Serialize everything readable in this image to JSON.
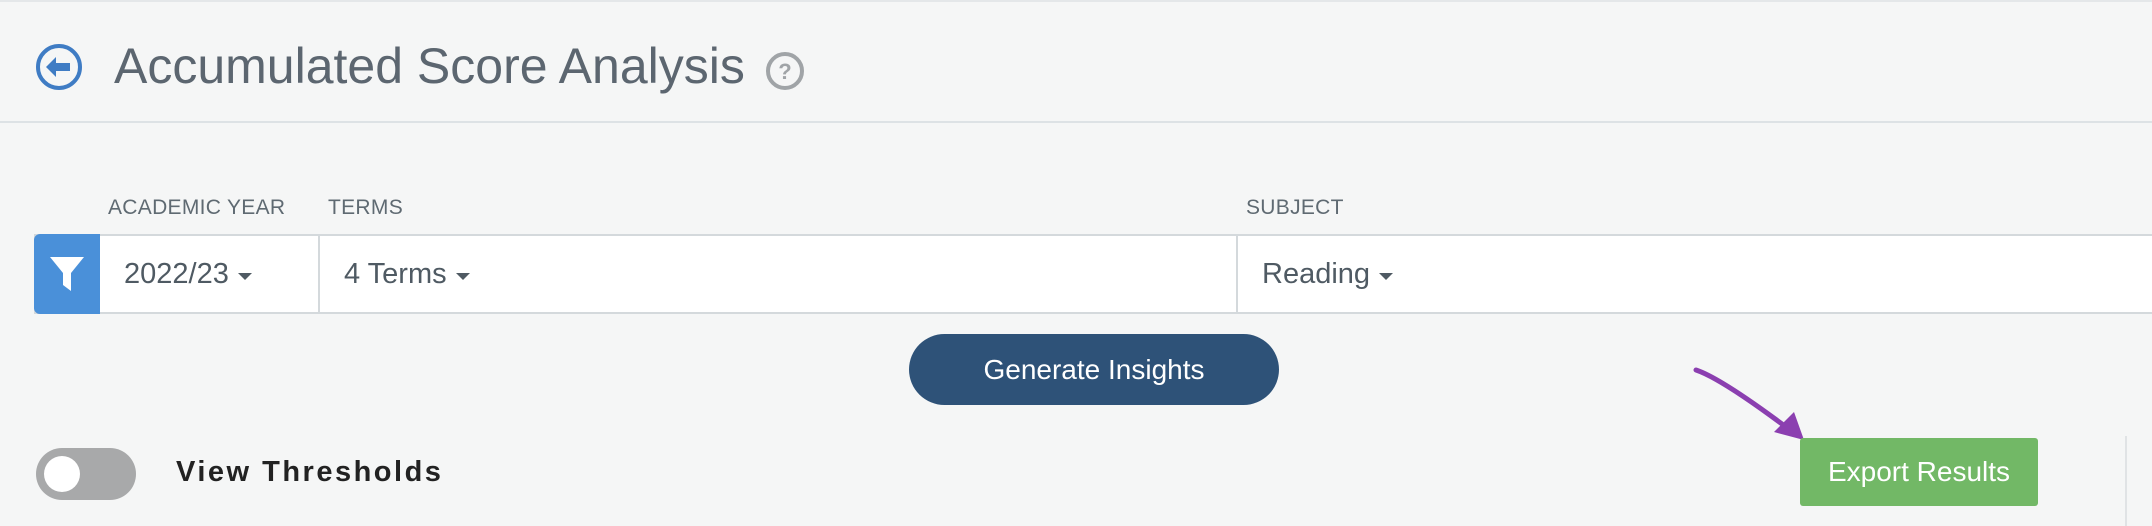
{
  "header": {
    "title": "Accumulated Score Analysis"
  },
  "filters": {
    "academic_year": {
      "label": "ACADEMIC YEAR",
      "value": "2022/23"
    },
    "terms": {
      "label": "TERMS",
      "value": "4 Terms"
    },
    "subject": {
      "label": "SUBJECT",
      "value": "Reading"
    }
  },
  "actions": {
    "generate_label": "Generate Insights",
    "export_label": "Export Results"
  },
  "toggle": {
    "label": "View Thresholds",
    "on": false
  },
  "icons": {
    "back": "back-arrow-circle-icon",
    "help": "help-question-circle-icon",
    "filter": "funnel-filter-icon",
    "caret": "caret-down-icon"
  },
  "colors": {
    "primary_blue": "#4a90d9",
    "navy_button": "#2e5278",
    "export_green": "#72b866",
    "annotation_purple": "#8b3fb0"
  }
}
